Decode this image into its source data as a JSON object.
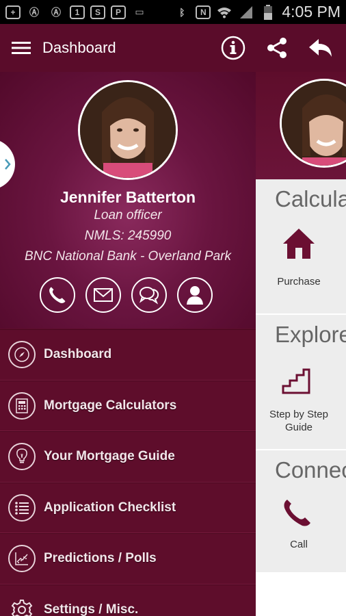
{
  "status_bar": {
    "time": "4:05 PM"
  },
  "toolbar": {
    "title": "Dashboard"
  },
  "profile": {
    "name": "Jennifer Batterton",
    "role": "Loan officer",
    "nmls": "NMLS: 245990",
    "company": "BNC National Bank - Overland Park"
  },
  "nav": {
    "items": [
      {
        "label": "Dashboard",
        "icon": "compass-icon"
      },
      {
        "label": "Mortgage Calculators",
        "icon": "calculator-icon"
      },
      {
        "label": "Your Mortgage Guide",
        "icon": "lightbulb-icon"
      },
      {
        "label": "Application Checklist",
        "icon": "list-icon"
      },
      {
        "label": "Predictions / Polls",
        "icon": "chart-icon"
      },
      {
        "label": "Settings / Misc.",
        "icon": "gear-icon"
      }
    ]
  },
  "background_page": {
    "sections": [
      {
        "title": "Calcula",
        "tile_label": "Purchase",
        "tile_icon": "house-icon"
      },
      {
        "title": "Explore",
        "tile_label": "Step by Step Guide",
        "tile_icon": "stairs-icon"
      },
      {
        "title": "Connec",
        "tile_label": "Call",
        "tile_icon": "phone-icon"
      }
    ]
  },
  "colors": {
    "brand": "#5e0d2b",
    "accent": "#6b0f32"
  }
}
